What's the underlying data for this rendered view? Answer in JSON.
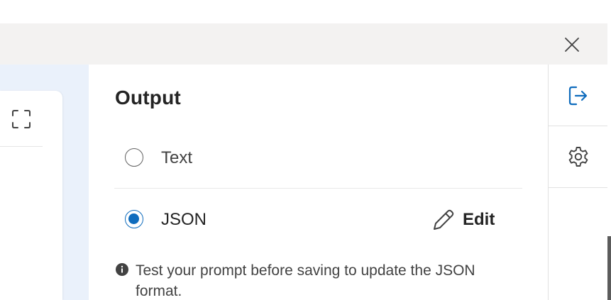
{
  "panel": {
    "title": "Output",
    "options": [
      {
        "label": "Text",
        "selected": false
      },
      {
        "label": "JSON",
        "selected": true
      }
    ],
    "edit_label": "Edit",
    "info_text": "Test your prompt before saving to update the JSON format."
  },
  "icons": {
    "close": "close-icon",
    "expand": "expand-icon",
    "output_rail": "sign-out-icon",
    "settings_rail": "gear-icon",
    "edit": "pencil-icon",
    "info": "info-icon"
  },
  "colors": {
    "accent": "#0f6cbd",
    "header_bg": "#f3f2f1",
    "canvas_bg": "#eaf1fb"
  }
}
